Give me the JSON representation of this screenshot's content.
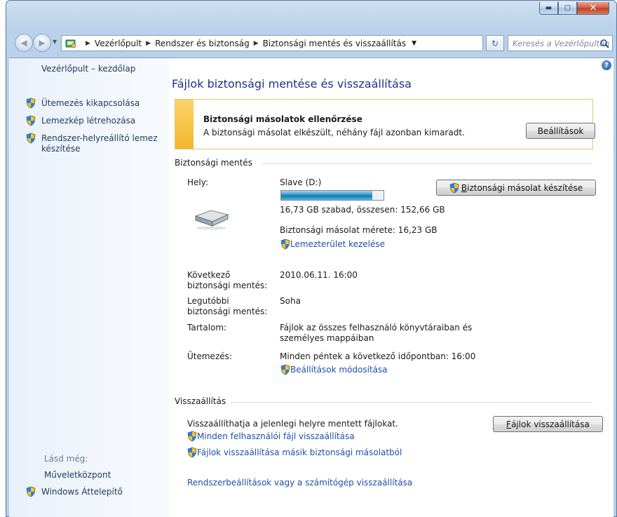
{
  "window": {
    "caption_buttons": {
      "minimize": "▬",
      "maximize": "▢",
      "close": "✕"
    }
  },
  "address_bar": {
    "crumbs": [
      "Vezérlőpult",
      "Rendszer és biztonság",
      "Biztonsági mentés és visszaállítás"
    ],
    "search_placeholder": "Keresés a Vezérlőpulton",
    "icons": {
      "back": "back-arrow-icon",
      "forward": "forward-arrow-icon",
      "refresh": "refresh-icon",
      "search": "search-icon"
    }
  },
  "sidebar": {
    "home": "Vezérlőpult – kezdőlap",
    "tasks": [
      {
        "label": "Ütemezés kikapcsolása",
        "icon": "uac-shield-icon"
      },
      {
        "label": "Lemezkép létrehozása",
        "icon": "uac-shield-icon"
      },
      {
        "label_lines": [
          "Rendszer-helyreállító lemez",
          "készítése"
        ],
        "icon": "uac-shield-icon"
      }
    ],
    "see_also_title": "Lásd még:",
    "see_also": [
      {
        "label": "Műveletközpont",
        "icon": null
      },
      {
        "label": "Windows Áttelepítő",
        "icon": "uac-shield-icon"
      }
    ]
  },
  "main": {
    "title": "Fájlok biztonsági mentése és visszaállítása",
    "notice": {
      "title": "Biztonsági másolatok ellenőrzése",
      "text": "A biztonsági másolat elkészült, néhány fájl azonban kimaradt.",
      "button": "Beállítások",
      "accent_color": "#f2b52e"
    },
    "backup": {
      "section_title": "Biztonsági mentés",
      "location_label": "Hely:",
      "location_value": "Slave (D:)",
      "drive_used_fraction": 0.89,
      "free_text": "16,73 GB szabad, összesen: 152,66 GB",
      "size_text": "Biztonsági másolat mérete: 16,23 GB",
      "manage_link": "Lemezterület kezelése",
      "backup_now_button_prefix": "",
      "backup_now_button_underlined": "B",
      "backup_now_button_rest": "iztonsági másolat készítése",
      "next_label_lines": [
        "Következő",
        "biztonsági mentés:"
      ],
      "next_value": "2010.06.11. 16:00",
      "last_label_lines": [
        "Legutóbbi",
        "biztonsági mentés:"
      ],
      "last_value": "Soha",
      "contents_label": "Tartalom:",
      "contents_value_lines": [
        "Fájlok az összes felhasználó könyvtáraiban és",
        "személyes mappáiban"
      ],
      "schedule_label": "Ütemezés:",
      "schedule_value": "Minden péntek a következő időpontban: 16:00",
      "change_settings_link": "Beállítások módosítása"
    },
    "restore": {
      "section_title": "Visszaállítás",
      "text": "Visszaállíthatja a jelenlegi helyre mentett fájlokat.",
      "button_underlined": "F",
      "button_rest": "ájlok visszaállítása",
      "all_users_link": "Minden felhasználói fájl visszaállítása",
      "other_backup_link": "Fájlok visszaállítása másik biztonsági másolatból",
      "system_link": "Rendszerbeállítások vagy a számítógép visszaállítása"
    }
  }
}
